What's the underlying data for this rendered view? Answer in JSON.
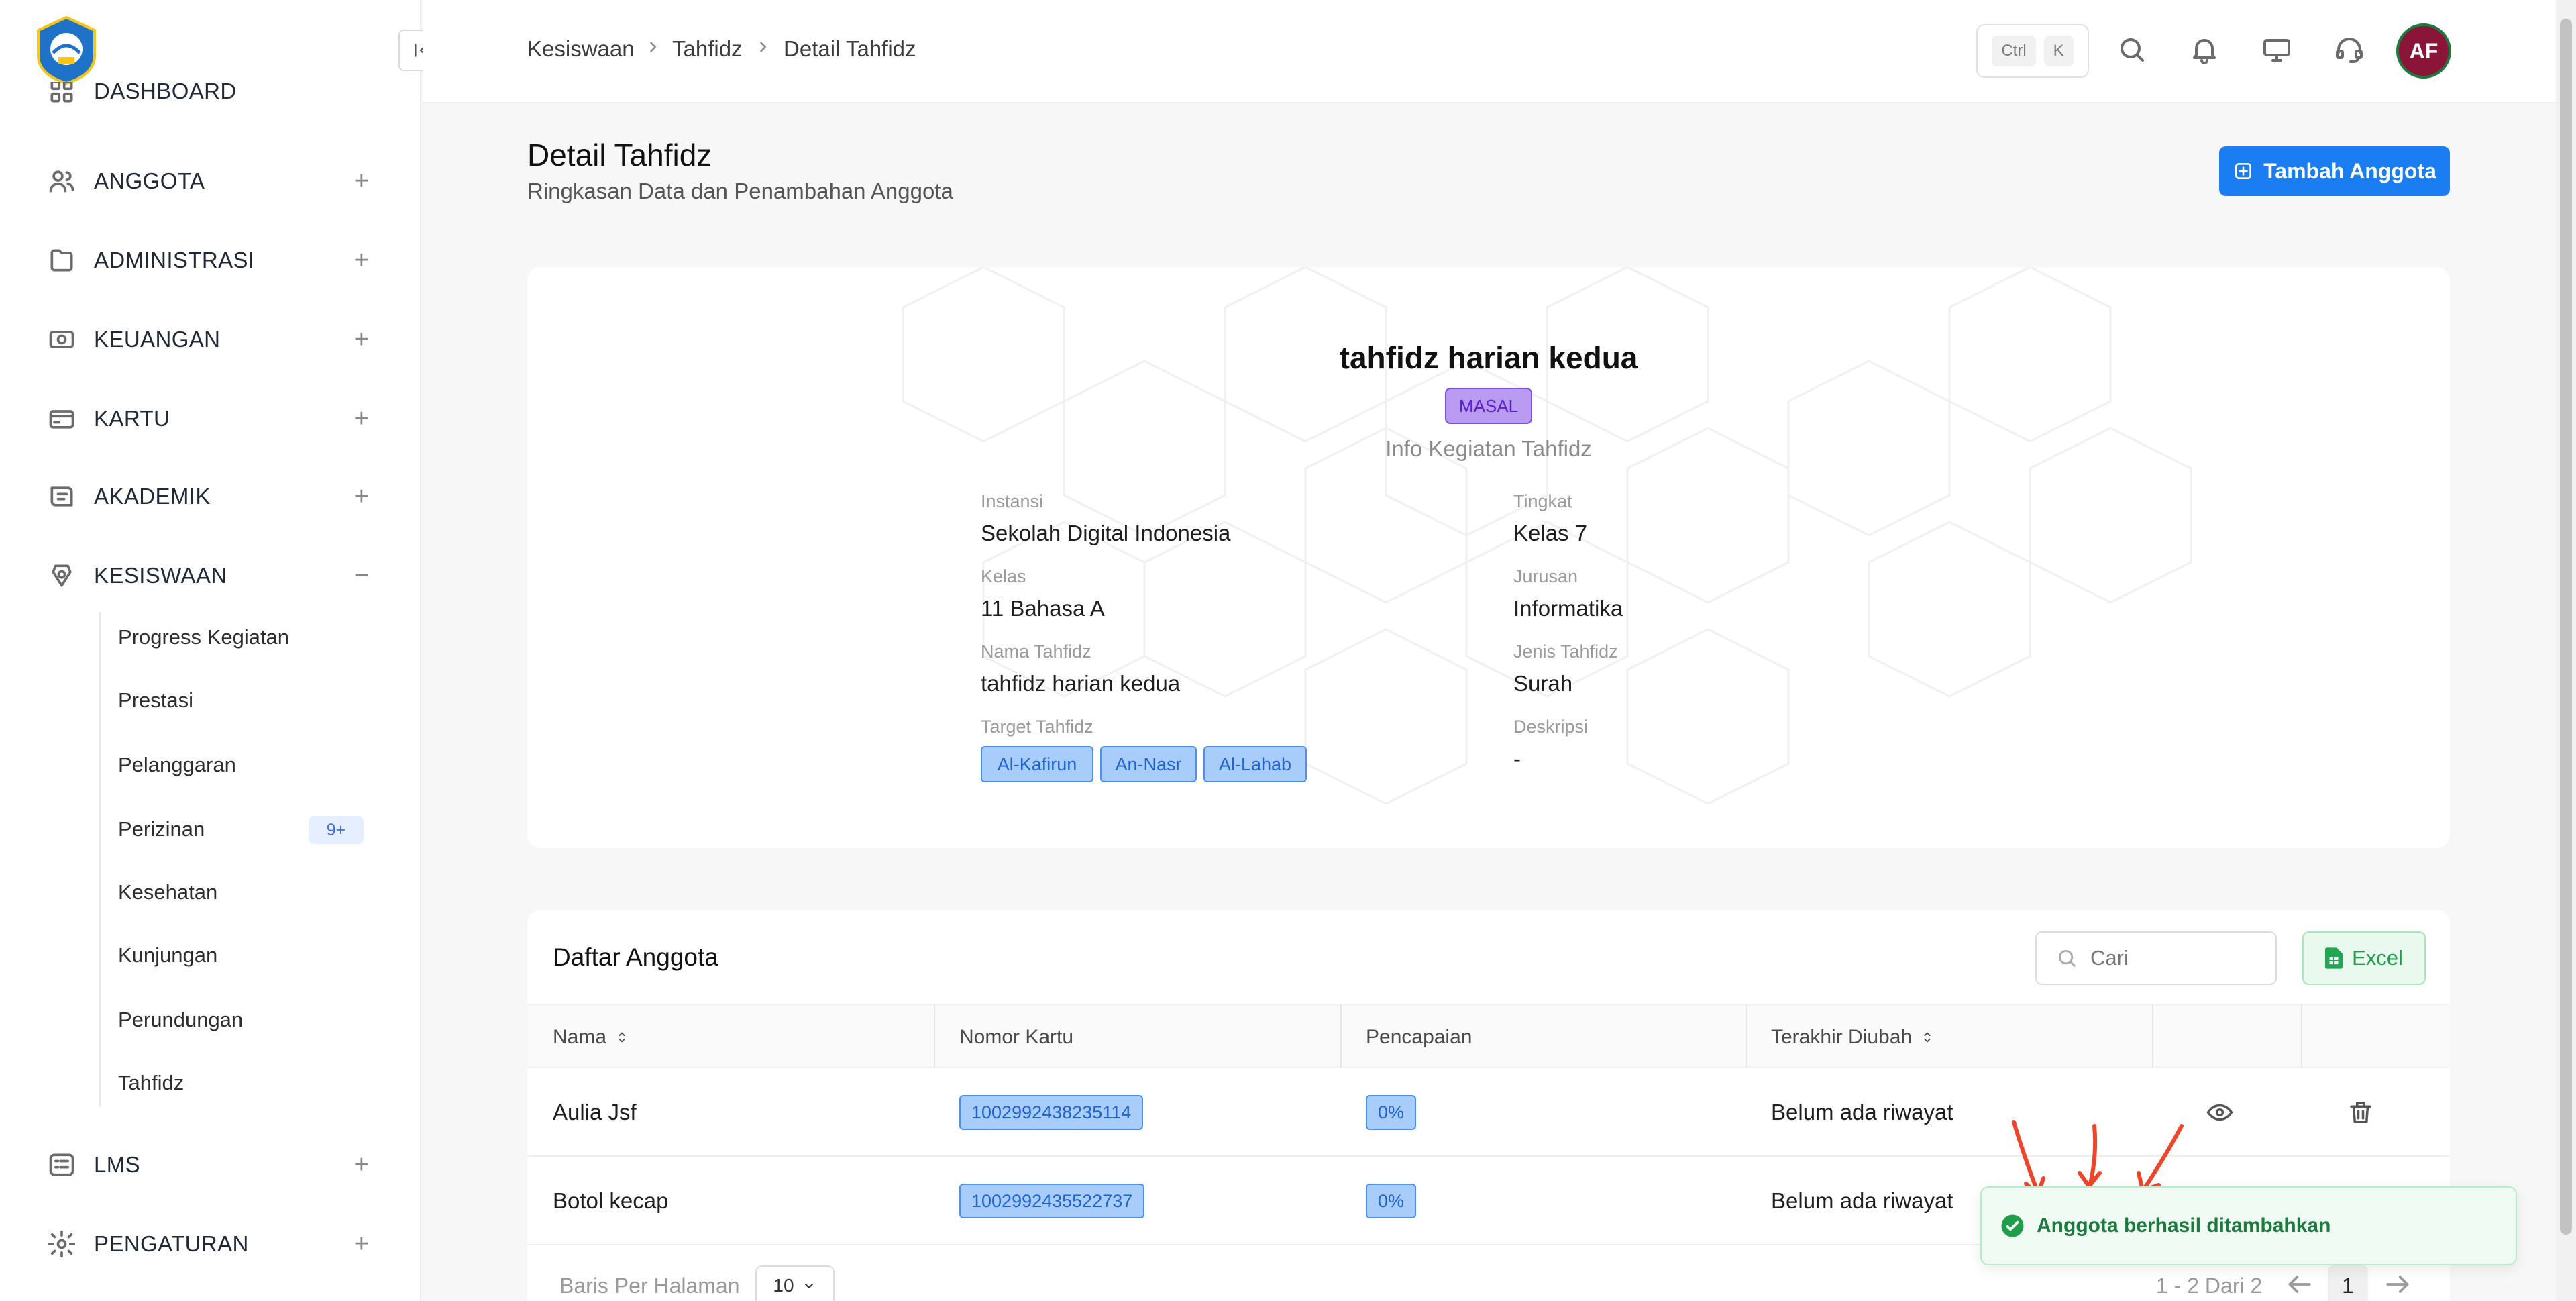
{
  "sidebar": {
    "items": [
      {
        "label": "DASHBOARD",
        "icon": "grid-icon"
      },
      {
        "label": "ANGGOTA",
        "icon": "users-icon",
        "toggle": "+"
      },
      {
        "label": "ADMINISTRASI",
        "icon": "folder-icon",
        "toggle": "+"
      },
      {
        "label": "KEUANGAN",
        "icon": "money-icon",
        "toggle": "+"
      },
      {
        "label": "KARTU",
        "icon": "card-icon",
        "toggle": "+"
      },
      {
        "label": "AKADEMIK",
        "icon": "academic-icon",
        "toggle": "+"
      },
      {
        "label": "KESISWAAN",
        "icon": "student-icon",
        "toggle": "−"
      },
      {
        "label": "LMS",
        "icon": "list-icon",
        "toggle": "+"
      },
      {
        "label": "PENGATURAN",
        "icon": "gear-icon",
        "toggle": "+"
      }
    ],
    "sub_items": [
      {
        "label": "Progress Kegiatan"
      },
      {
        "label": "Prestasi"
      },
      {
        "label": "Pelanggaran"
      },
      {
        "label": "Perizinan",
        "badge": "9+"
      },
      {
        "label": "Kesehatan"
      },
      {
        "label": "Kunjungan"
      },
      {
        "label": "Perundungan"
      },
      {
        "label": "Tahfidz"
      }
    ]
  },
  "breadcrumb": [
    "Kesiswaan",
    "Tahfidz",
    "Detail Tahfidz"
  ],
  "topbar": {
    "kbd1": "Ctrl",
    "kbd2": "K",
    "avatar": "AF"
  },
  "header": {
    "title": "Detail Tahfidz",
    "subtitle": "Ringkasan Data dan Penambahan Anggota",
    "add_button": "Tambah Anggota"
  },
  "info": {
    "title": "tahfidz harian kedua",
    "type_badge": "MASAL",
    "subtitle": "Info Kegiatan Tahfidz",
    "fields": {
      "instansi_label": "Instansi",
      "instansi": "Sekolah Digital Indonesia",
      "tingkat_label": "Tingkat",
      "tingkat": "Kelas 7",
      "kelas_label": "Kelas",
      "kelas": "11 Bahasa A",
      "jurusan_label": "Jurusan",
      "jurusan": "Informatika",
      "nama_label": "Nama Tahfidz",
      "nama": "tahfidz harian kedua",
      "jenis_label": "Jenis Tahfidz",
      "jenis": "Surah",
      "target_label": "Target Tahfidz",
      "deskripsi_label": "Deskripsi",
      "deskripsi": "-"
    },
    "targets": [
      "Al-Kafirun",
      "An-Nasr",
      "Al-Lahab"
    ]
  },
  "table": {
    "title": "Daftar Anggota",
    "search_placeholder": "Cari",
    "excel_label": "Excel",
    "columns": [
      "Nama",
      "Nomor Kartu",
      "Pencapaian",
      "Terakhir Diubah"
    ],
    "rows": [
      {
        "nama": "Aulia Jsf",
        "kartu": "1002992438235114",
        "pencapaian": "0%",
        "diubah": "Belum ada riwayat"
      },
      {
        "nama": "Botol kecap",
        "kartu": "1002992435522737",
        "pencapaian": "0%",
        "diubah": "Belum ada riwayat"
      }
    ]
  },
  "pagination": {
    "rows_label": "Baris Per Halaman",
    "rows_value": "10",
    "range": "1 - 2 Dari 2",
    "page": "1"
  },
  "toast": {
    "message": "Anggota berhasil ditambahkan"
  },
  "colors": {
    "primary": "#1a7df2",
    "success": "#1c7a3f",
    "badge_purple": "#b99cf2",
    "tag_blue": "#a9cdfb",
    "arrow_red": "#f0452a"
  }
}
